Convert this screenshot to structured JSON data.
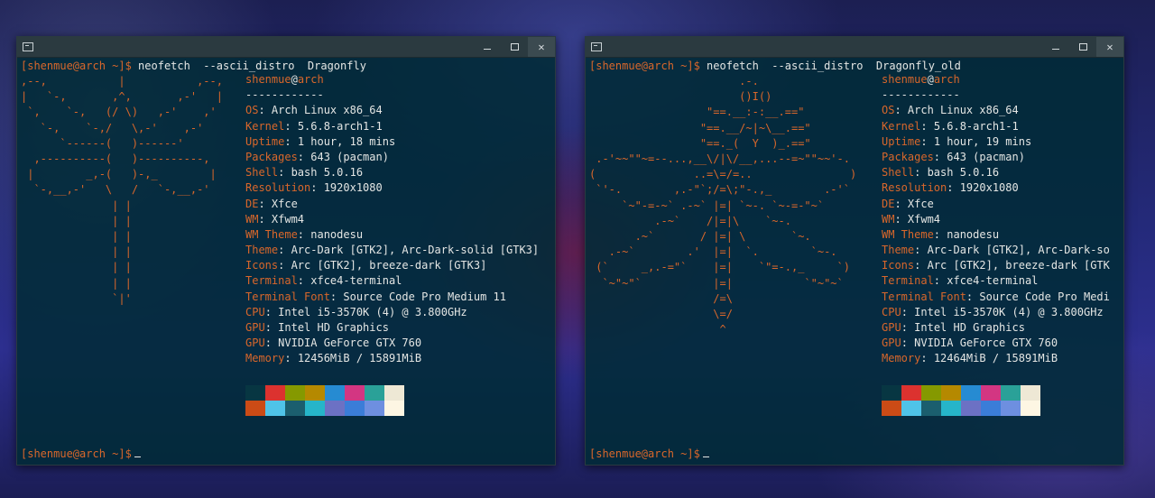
{
  "windows": [
    {
      "command_prompt": "[shenmue@arch ~]$",
      "command": " neofetch  --ascii_distro  Dragonfly",
      "ascii_art": [
        ",--,           |           ,--,",
        "|   `-,       ,^,       ,-'   |",
        " `,    `-,   (/ \\)   ,-'    ,'",
        "   `-,    `-,/   \\,-'    ,-'",
        "      `------(   )------'",
        "  ,----------(   )----------,",
        " |        _,-(   )-,_        |",
        "  `-,__,-'   \\   /   `-,__,-'",
        "              | |",
        "              | |",
        "              | |",
        "              | |",
        "              | |",
        "              | |",
        "              `|'"
      ],
      "header_user": "shenmue",
      "header_at": "@",
      "header_host": "arch",
      "separator": "------------",
      "info": [
        {
          "key": "OS",
          "value": "Arch Linux x86_64"
        },
        {
          "key": "Kernel",
          "value": "5.6.8-arch1-1"
        },
        {
          "key": "Uptime",
          "value": "1 hour, 18 mins"
        },
        {
          "key": "Packages",
          "value": "643 (pacman)"
        },
        {
          "key": "Shell",
          "value": "bash 5.0.16"
        },
        {
          "key": "Resolution",
          "value": "1920x1080"
        },
        {
          "key": "DE",
          "value": "Xfce"
        },
        {
          "key": "WM",
          "value": "Xfwm4"
        },
        {
          "key": "WM Theme",
          "value": "nanodesu"
        },
        {
          "key": "Theme",
          "value": "Arc-Dark [GTK2], Arc-Dark-solid [GTK3]"
        },
        {
          "key": "Icons",
          "value": "Arc [GTK2], breeze-dark [GTK3]"
        },
        {
          "key": "Terminal",
          "value": "xfce4-terminal"
        },
        {
          "key": "Terminal Font",
          "value": "Source Code Pro Medium 11"
        },
        {
          "key": "CPU",
          "value": "Intel i5-3570K (4) @ 3.800GHz"
        },
        {
          "key": "GPU",
          "value": "Intel HD Graphics"
        },
        {
          "key": "GPU",
          "value": "NVIDIA GeForce GTX 760"
        },
        {
          "key": "Memory",
          "value": "12456MiB / 15891MiB"
        }
      ],
      "bottom_prompt": "[shenmue@arch ~]$"
    },
    {
      "command_prompt": "[shenmue@arch ~]$",
      "command": " neofetch  --ascii_distro  Dragonfly_old",
      "ascii_art": [
        "                       .-.",
        "                       ()I()",
        "                  \"==.__:-:__.==\"",
        "                 \"==.__/~|~\\__.==\"",
        "                 \"==._(  Y  )_.==\"",
        " .-'~~\"\"~=--...,__\\/|\\/__,...--=~\"\"~~'-.",
        "(               ..=\\=/=..               )",
        " `'-.        ,.-\"`;/=\\;\"-.,_        .-'`",
        "     `~\"-=-~` .-~` |=| `~-. `~-=-\"~`",
        "          .-~`    /|=|\\    `~-.",
        "       .~`       / |=| \\       `~.",
        "   .-~`        .'  |=|  `.        `~-.",
        " (`     _,.-=\"`    |=|    `\"=-.,_     `)",
        "  `~\"~\"`           |=|           `\"~\"~`",
        "                   /=\\",
        "                   \\=/",
        "                    ^"
      ],
      "header_user": "shenmue",
      "header_at": "@",
      "header_host": "arch",
      "separator": "------------",
      "info": [
        {
          "key": "OS",
          "value": "Arch Linux x86_64"
        },
        {
          "key": "Kernel",
          "value": "5.6.8-arch1-1"
        },
        {
          "key": "Uptime",
          "value": "1 hour, 19 mins"
        },
        {
          "key": "Packages",
          "value": "643 (pacman)"
        },
        {
          "key": "Shell",
          "value": "bash 5.0.16"
        },
        {
          "key": "Resolution",
          "value": "1920x1080"
        },
        {
          "key": "DE",
          "value": "Xfce"
        },
        {
          "key": "WM",
          "value": "Xfwm4"
        },
        {
          "key": "WM Theme",
          "value": "nanodesu"
        },
        {
          "key": "Theme",
          "value": "Arc-Dark [GTK2], Arc-Dark-so"
        },
        {
          "key": "Icons",
          "value": "Arc [GTK2], breeze-dark [GTK"
        },
        {
          "key": "Terminal",
          "value": "xfce4-terminal"
        },
        {
          "key": "Terminal Font",
          "value": "Source Code Pro Medi"
        },
        {
          "key": "CPU",
          "value": "Intel i5-3570K (4) @ 3.800GHz"
        },
        {
          "key": "GPU",
          "value": "Intel HD Graphics"
        },
        {
          "key": "GPU",
          "value": "NVIDIA GeForce GTX 760"
        },
        {
          "key": "Memory",
          "value": "12464MiB / 15891MiB"
        }
      ],
      "bottom_prompt": "[shenmue@arch ~]$"
    }
  ],
  "palette_row1": [
    "#073642",
    "#dc322f",
    "#859900",
    "#b58900",
    "#268bd2",
    "#d33682",
    "#2aa198",
    "#eee8d5"
  ],
  "palette_row2": [
    "#cb4b16",
    "#4fc3e8",
    "#1b5e6e",
    "#26b5c9",
    "#6c71c4",
    "#3b7dd8",
    "#6e8fe0",
    "#fdf6e3"
  ],
  "colors": {
    "accent": "#d9672b",
    "terminal_bg": "#002b36",
    "text": "#e4e6e4"
  },
  "icons": [
    "terminal-icon",
    "minimize-icon",
    "maximize-icon",
    "close-icon"
  ]
}
